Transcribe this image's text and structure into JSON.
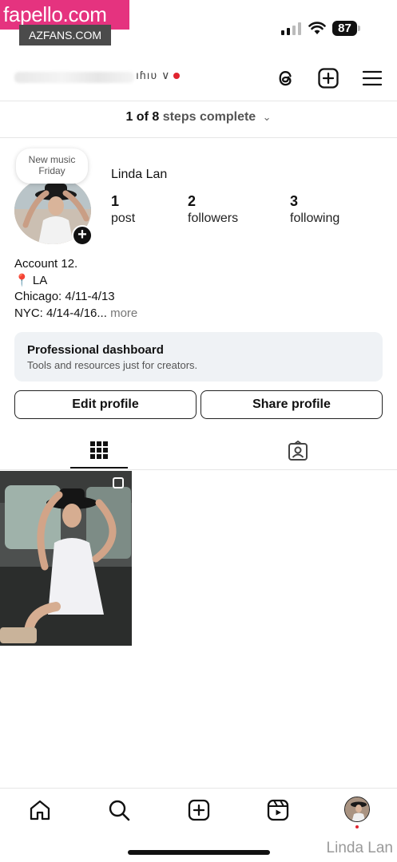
{
  "watermarks": {
    "site": "fapello.com",
    "tag": "AZFANS.COM",
    "corner": "Linda Lan"
  },
  "status_bar": {
    "battery": "87"
  },
  "header": {
    "username_visible_tail": "ıɦıʋ ∨"
  },
  "steps": {
    "count": "1 of 8",
    "rest": "steps complete"
  },
  "profile": {
    "note_line1": "New music",
    "note_line2": "Friday",
    "display_name": "Linda Lan",
    "stats": [
      {
        "num": "1",
        "label": "post"
      },
      {
        "num": "2",
        "label": "followers"
      },
      {
        "num": "3",
        "label": "following"
      }
    ],
    "bio_lines": [
      "Account 12.",
      "LA",
      "Chicago: 4/11-4/13",
      "NYC: 4/14-4/16..."
    ],
    "bio_more": "more"
  },
  "dashboard": {
    "title": "Professional dashboard",
    "subtitle": "Tools and resources just for creators."
  },
  "buttons": {
    "edit": "Edit profile",
    "share": "Share profile"
  },
  "icons": {
    "header": [
      "threads-icon",
      "create-icon",
      "menu-icon"
    ],
    "tabs": [
      "grid-icon",
      "tagged-icon"
    ],
    "nav": [
      "home-icon",
      "search-icon",
      "create-icon",
      "reels-icon",
      "profile-avatar"
    ]
  },
  "colors": {
    "accent_red": "#e0242f",
    "dashboard_bg": "#eff2f5",
    "watermark_pink": "#e5337f"
  }
}
